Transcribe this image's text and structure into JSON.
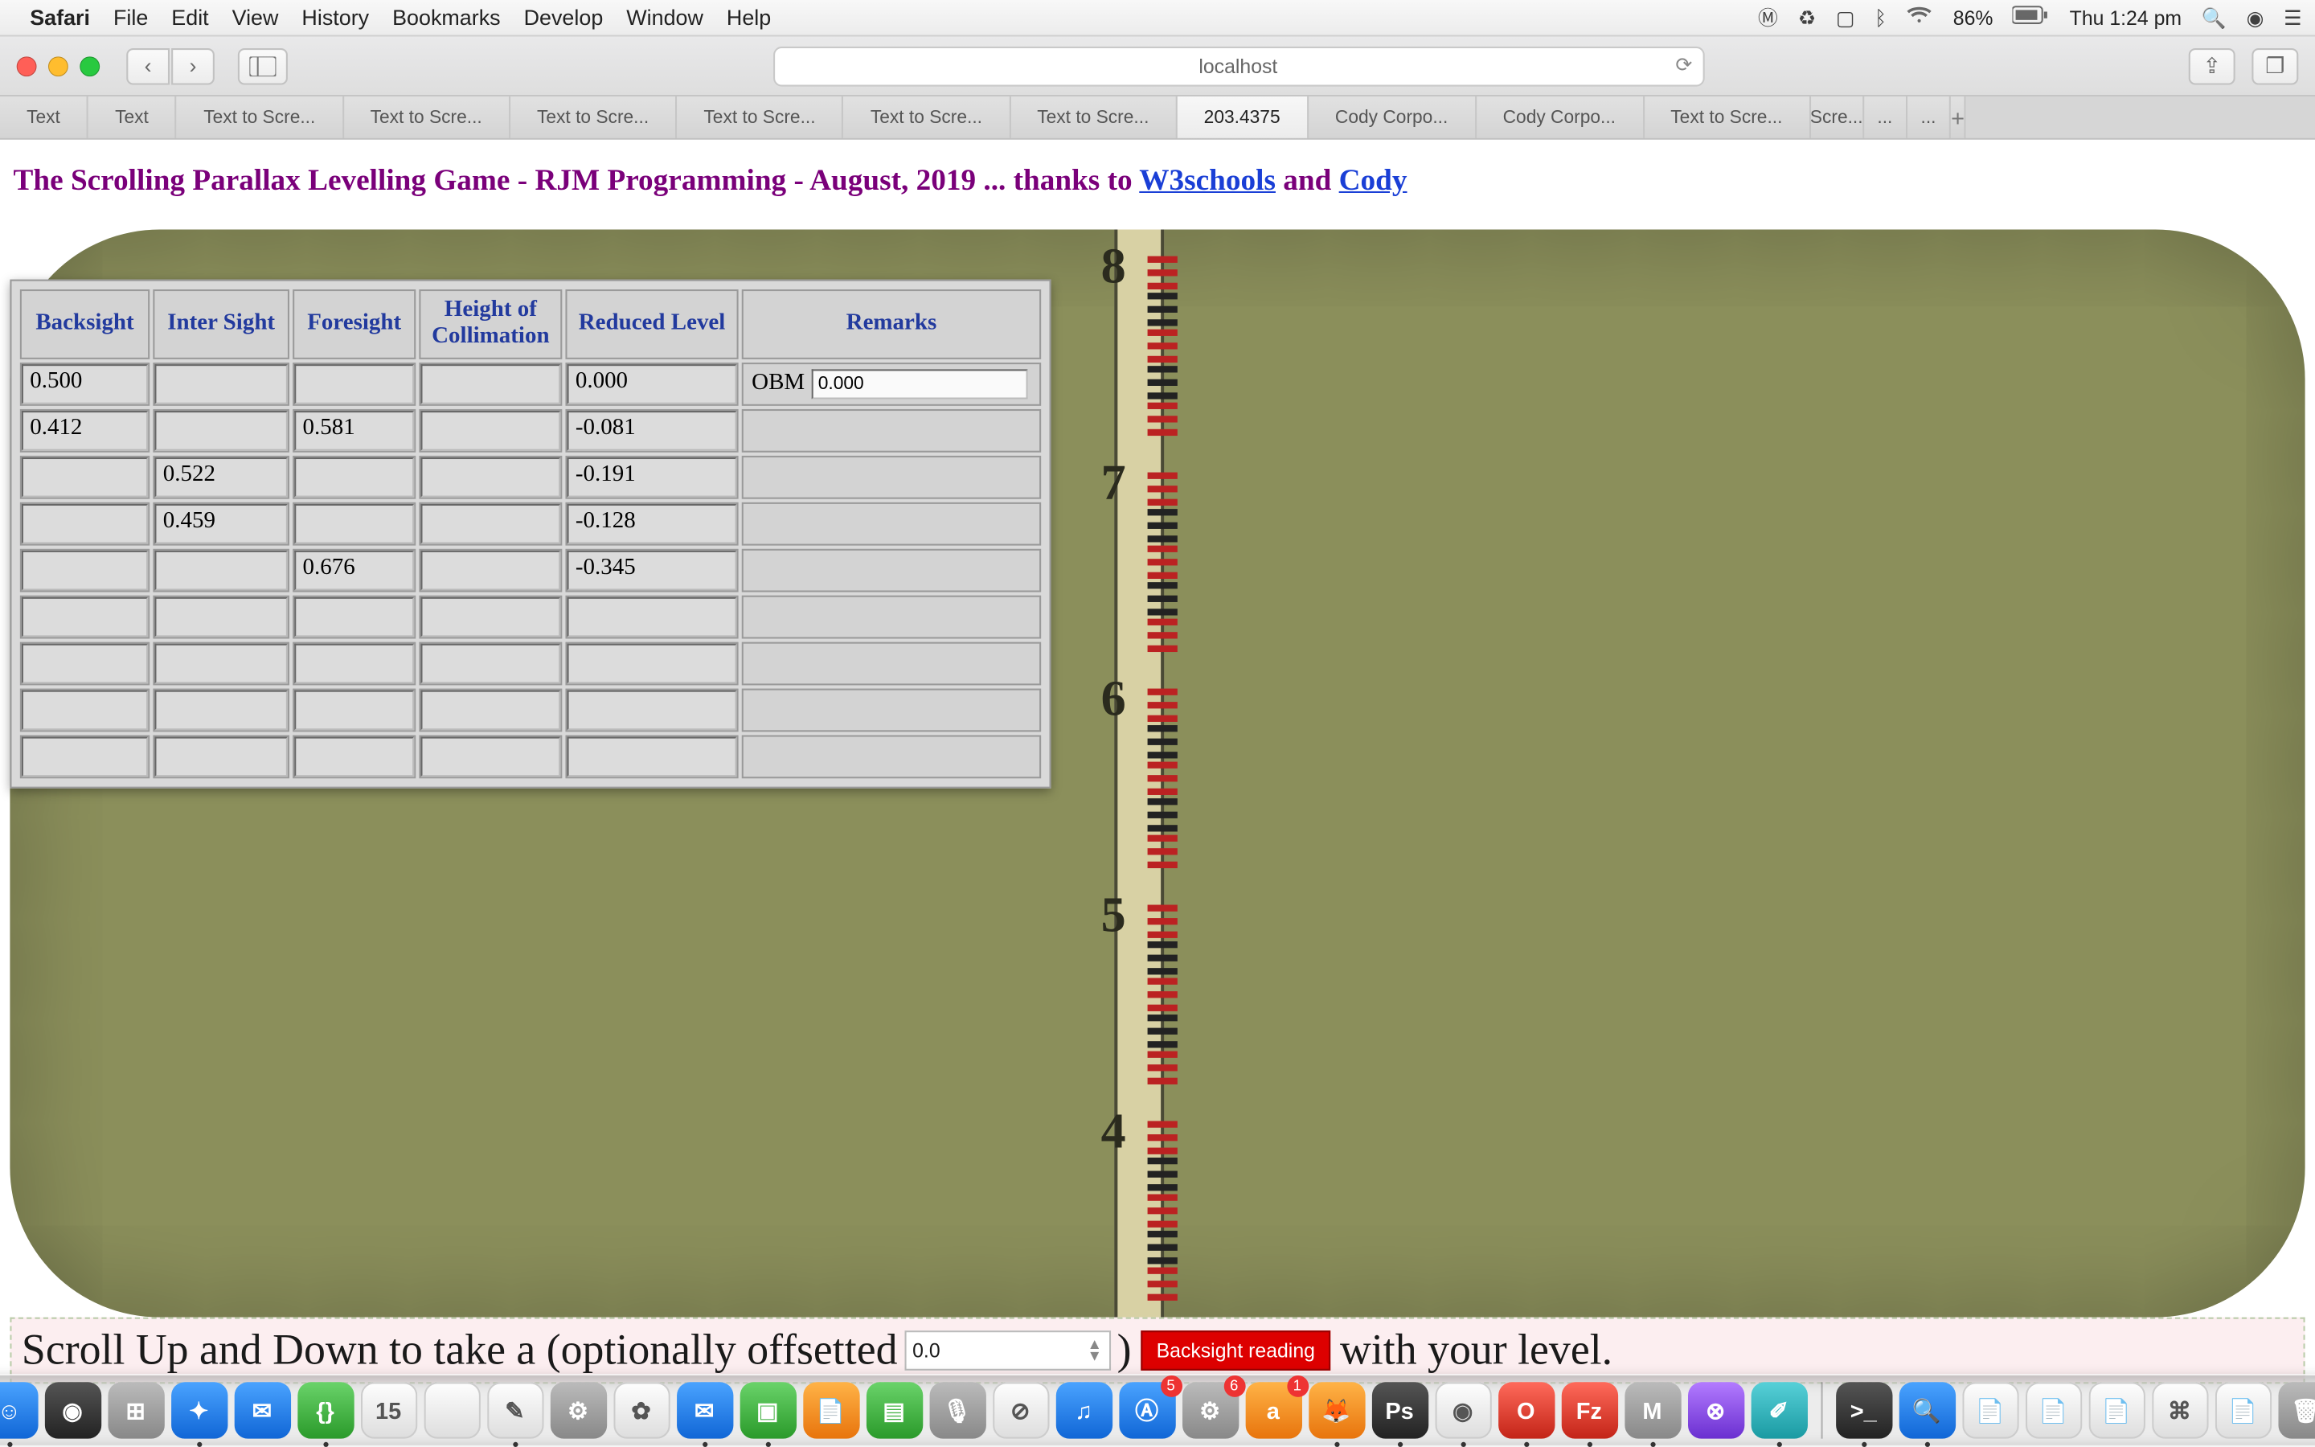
{
  "menubar": {
    "app": "Safari",
    "items": [
      "File",
      "Edit",
      "View",
      "History",
      "Bookmarks",
      "Develop",
      "Window",
      "Help"
    ],
    "battery": "86%",
    "clock": "Thu 1:24 pm"
  },
  "toolbar": {
    "address": "localhost"
  },
  "tabs": {
    "items": [
      {
        "label": "Text"
      },
      {
        "label": "Text"
      },
      {
        "label": "Text to Scre..."
      },
      {
        "label": "Text to Scre..."
      },
      {
        "label": "Text to Scre..."
      },
      {
        "label": "Text to Scre..."
      },
      {
        "label": "Text to Scre..."
      },
      {
        "label": "Text to Scre..."
      },
      {
        "label": "203.4375",
        "active": true
      },
      {
        "label": "Cody Corpo..."
      },
      {
        "label": "Cody Corpo..."
      },
      {
        "label": "Text to Scre..."
      },
      {
        "label": "Scre...",
        "small": true
      },
      {
        "label": "...",
        "small": true
      },
      {
        "label": "...",
        "small": true
      }
    ]
  },
  "page": {
    "title_prefix": "The Scrolling Parallax Levelling Game - RJM Programming - August, 2019 ... thanks to ",
    "link1": "W3schools",
    "title_mid": " and ",
    "link2": "Cody"
  },
  "table": {
    "headers": [
      "Backsight",
      "Inter Sight",
      "Foresight",
      "Height of Collimation",
      "Reduced Level",
      "Remarks"
    ],
    "rows": [
      {
        "bs": "0.500",
        "is": "",
        "fs": "",
        "hc": "",
        "rl": "0.000",
        "rm_label": "OBM",
        "rm_input": "0.000"
      },
      {
        "bs": "0.412",
        "is": "",
        "fs": "0.581",
        "hc": "",
        "rl": "-0.081",
        "rm_label": "",
        "rm_input": ""
      },
      {
        "bs": "",
        "is": "0.522",
        "fs": "",
        "hc": "",
        "rl": "-0.191",
        "rm_label": "",
        "rm_input": ""
      },
      {
        "bs": "",
        "is": "0.459",
        "fs": "",
        "hc": "",
        "rl": "-0.128",
        "rm_label": "",
        "rm_input": ""
      },
      {
        "bs": "",
        "is": "",
        "fs": "0.676",
        "hc": "",
        "rl": "-0.345",
        "rm_label": "",
        "rm_input": ""
      },
      {
        "bs": "",
        "is": "",
        "fs": "",
        "hc": "",
        "rl": "",
        "rm_label": "",
        "rm_input": ""
      },
      {
        "bs": "",
        "is": "",
        "fs": "",
        "hc": "",
        "rl": "",
        "rm_label": "",
        "rm_input": ""
      },
      {
        "bs": "",
        "is": "",
        "fs": "",
        "hc": "",
        "rl": "",
        "rm_label": "",
        "rm_input": ""
      },
      {
        "bs": "",
        "is": "",
        "fs": "",
        "hc": "",
        "rl": "",
        "rm_label": "",
        "rm_input": ""
      }
    ]
  },
  "staff": {
    "numbers": [
      "8",
      "7",
      "6",
      "5",
      "4"
    ]
  },
  "instr": {
    "t1": "Scroll Up and Down to take a (optionally offsetted ",
    "num": "0.0",
    "t2": " ) ",
    "btn": "Backsight reading",
    "t3": " with your level."
  },
  "dock": {
    "apps": [
      {
        "n": "finder",
        "c": "g-blue",
        "t": "☺",
        "dot": true
      },
      {
        "n": "siri",
        "c": "g-dark",
        "t": "◉"
      },
      {
        "n": "launchpad",
        "c": "g-grey",
        "t": "⊞"
      },
      {
        "n": "safari",
        "c": "g-blue",
        "t": "✦",
        "dot": true
      },
      {
        "n": "mail",
        "c": "g-blue",
        "t": "✉"
      },
      {
        "n": "coda",
        "c": "g-green",
        "t": "{}",
        "dot": true
      },
      {
        "n": "calendar",
        "c": "g-white",
        "t": "15",
        "badge": ""
      },
      {
        "n": "blank1",
        "c": "g-white",
        "t": ""
      },
      {
        "n": "notes",
        "c": "g-white",
        "t": "✎",
        "dot": true
      },
      {
        "n": "settings",
        "c": "g-grey",
        "t": "⚙"
      },
      {
        "n": "photos",
        "c": "g-white",
        "t": "✿"
      },
      {
        "n": "messages",
        "c": "g-blue",
        "t": "✉",
        "dot": true
      },
      {
        "n": "facetime",
        "c": "g-green",
        "t": "▣",
        "dot": true
      },
      {
        "n": "pages",
        "c": "g-orange",
        "t": "📄"
      },
      {
        "n": "numbers",
        "c": "g-green",
        "t": "▤"
      },
      {
        "n": "mic",
        "c": "g-grey",
        "t": "🎙"
      },
      {
        "n": "block",
        "c": "g-white",
        "t": "⊘"
      },
      {
        "n": "itunes",
        "c": "g-blue",
        "t": "♫"
      },
      {
        "n": "appstore",
        "c": "g-blue",
        "t": "Ⓐ",
        "badge": "5"
      },
      {
        "n": "sys",
        "c": "g-grey",
        "t": "⚙",
        "badge": "6"
      },
      {
        "n": "avast",
        "c": "g-orange",
        "t": "a",
        "badge": "1"
      },
      {
        "n": "firefox",
        "c": "g-orange",
        "t": "🦊",
        "dot": true
      },
      {
        "n": "ps",
        "c": "g-dark",
        "t": "Ps",
        "dot": true
      },
      {
        "n": "chrome",
        "c": "g-white",
        "t": "◉",
        "dot": true
      },
      {
        "n": "opera",
        "c": "g-red",
        "t": "O",
        "dot": true
      },
      {
        "n": "filezilla",
        "c": "g-red",
        "t": "Fz",
        "dot": true
      },
      {
        "n": "mamp",
        "c": "g-grey",
        "t": "M",
        "dot": true
      },
      {
        "n": "octo",
        "c": "g-purple",
        "t": "⊗"
      },
      {
        "n": "paint",
        "c": "g-teal",
        "t": "✐",
        "dot": true
      }
    ],
    "right": [
      {
        "n": "terminal",
        "c": "g-dark",
        "t": ">_",
        "dot": true
      },
      {
        "n": "search",
        "c": "g-blue",
        "t": "🔍",
        "dot": true
      },
      {
        "n": "doc1",
        "c": "g-white",
        "t": "📄"
      },
      {
        "n": "doc2",
        "c": "g-white",
        "t": "📄"
      },
      {
        "n": "doc3",
        "c": "g-white",
        "t": "📄"
      },
      {
        "n": "html",
        "c": "g-white",
        "t": "⌘"
      },
      {
        "n": "doc4",
        "c": "g-white",
        "t": "📄"
      },
      {
        "n": "trash",
        "c": "g-grey",
        "t": "🗑"
      }
    ]
  }
}
